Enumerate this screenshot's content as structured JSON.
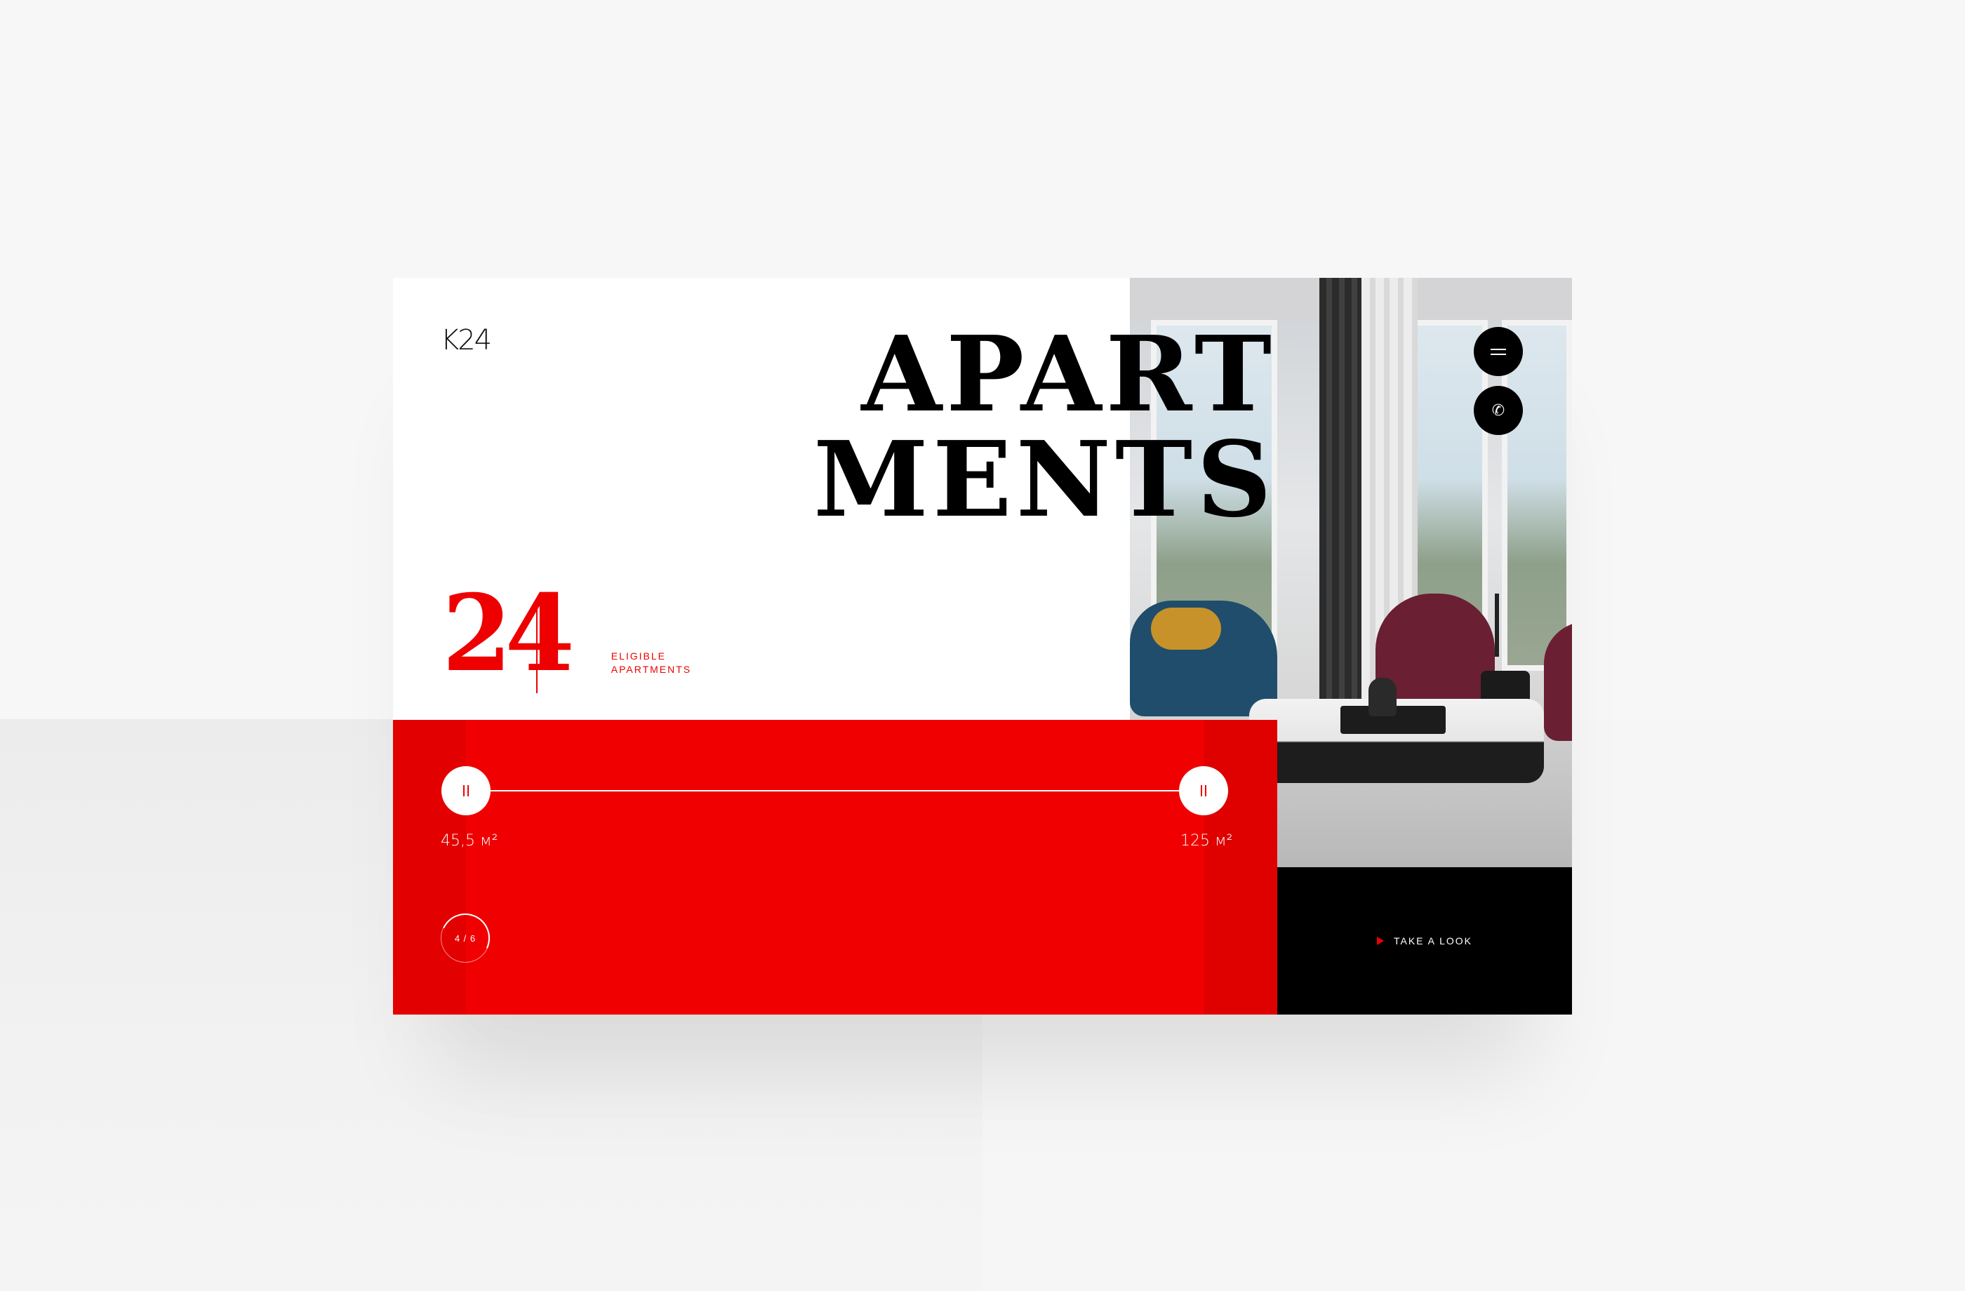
{
  "brand": {
    "logo": "K24"
  },
  "hero": {
    "headline_line1": "APART",
    "headline_line2": "MENTS",
    "count": "24",
    "count_label": "ELIGIBLE APARTMENTS"
  },
  "header_actions": {
    "menu_icon": "menu-icon",
    "call_icon": "phone-icon",
    "call_glyph": "✆"
  },
  "filter": {
    "area_min": "45,5 м²",
    "area_max": "125 м²",
    "pager": "4 / 6"
  },
  "cta": {
    "label": "TAKE A LOOK"
  },
  "colors": {
    "accent_red": "#f00000",
    "dark": "#000000",
    "background": "#f7f7f7"
  }
}
